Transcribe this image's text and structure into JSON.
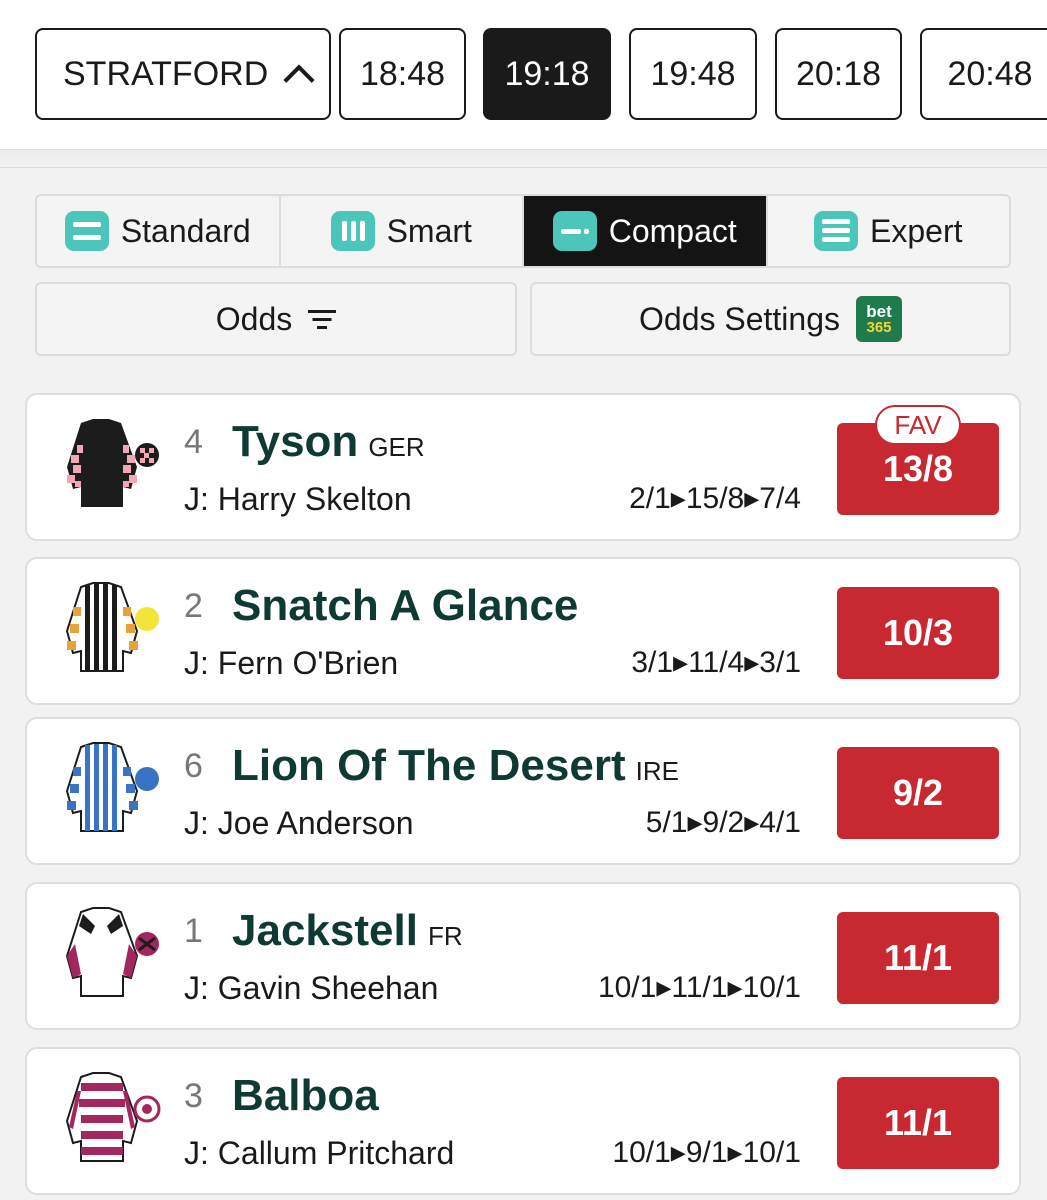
{
  "race_bar": {
    "venue": "STRATFORD",
    "times": [
      {
        "label": "18:48",
        "active": false
      },
      {
        "label": "19:18",
        "active": true
      },
      {
        "label": "19:48",
        "active": false
      },
      {
        "label": "20:18",
        "active": false
      },
      {
        "label": "20:48",
        "active": false
      }
    ]
  },
  "view_tabs": [
    {
      "label": "Standard",
      "icon": "standard-view-icon",
      "active": false
    },
    {
      "label": "Smart",
      "icon": "smart-view-icon",
      "active": false
    },
    {
      "label": "Compact",
      "icon": "compact-view-icon",
      "active": true
    },
    {
      "label": "Expert",
      "icon": "expert-view-icon",
      "active": false
    }
  ],
  "odds_sort": {
    "label": "Odds",
    "icon": "filter-icon"
  },
  "odds_settings": {
    "label": "Odds Settings",
    "logo_top": "bet",
    "logo_bottom": "365"
  },
  "colors": {
    "accent_teal": "#4cc6bb",
    "odds_red": "#c8282f",
    "name_green": "#0f3a33"
  },
  "runners": [
    {
      "number": "4",
      "name": "Tyson",
      "nationality": "GER",
      "jockey": "J: Harry Skelton",
      "odds_history": "2/1▸15/8▸7/4",
      "odds": "13/8",
      "badge": "FAV"
    },
    {
      "number": "2",
      "name": "Snatch A Glance",
      "nationality": "",
      "jockey": "J: Fern O'Brien",
      "odds_history": "3/1▸11/4▸3/1",
      "odds": "10/3"
    },
    {
      "number": "6",
      "name": "Lion Of The Desert",
      "nationality": "IRE",
      "jockey": "J: Joe Anderson",
      "odds_history": "5/1▸9/2▸4/1",
      "odds": "9/2"
    },
    {
      "number": "1",
      "name": "Jackstell",
      "nationality": "FR",
      "jockey": "J: Gavin Sheehan",
      "odds_history": "10/1▸11/1▸10/1",
      "odds": "11/1"
    },
    {
      "number": "3",
      "name": "Balboa",
      "nationality": "",
      "jockey": "J: Callum Pritchard",
      "odds_history": "10/1▸9/1▸10/1",
      "odds": "11/1"
    }
  ]
}
